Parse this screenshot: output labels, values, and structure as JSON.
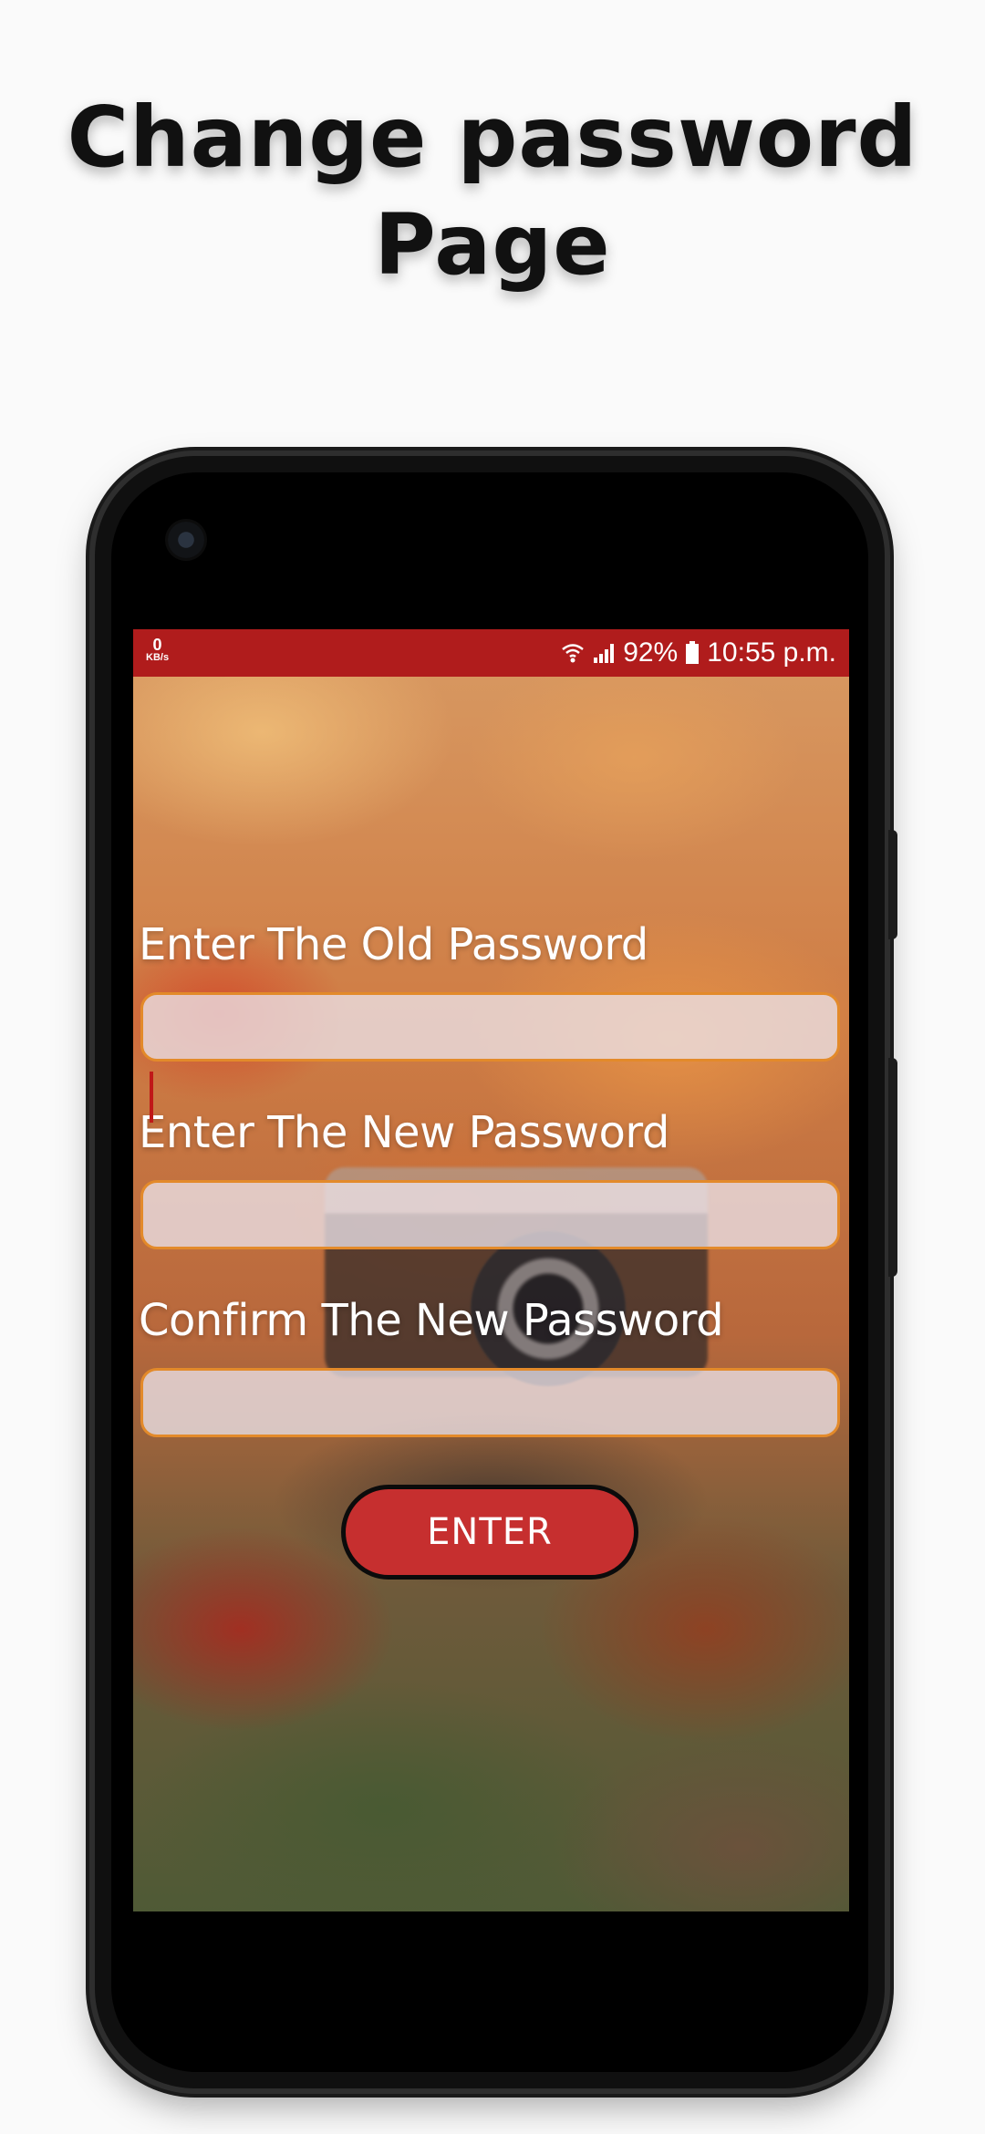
{
  "headline": {
    "line1": "Change password",
    "line2": "Page"
  },
  "status_bar": {
    "net_speed_value": "0",
    "net_speed_unit": "KB/s",
    "battery": "92%",
    "time": "10:55 p.m.",
    "icons": [
      "wifi-icon",
      "signal-icon",
      "battery-icon"
    ],
    "color": "#b01c1c"
  },
  "form": {
    "old_password_label": "Enter The Old Password",
    "old_password_value": "",
    "new_password_label": "Enter The New Password",
    "new_password_value": "",
    "confirm_password_label": "Confirm The New Password",
    "confirm_password_value": "",
    "field_border_color": "#e38a2a"
  },
  "enter_button": {
    "label": "ENTER",
    "color": "#c62f2f"
  }
}
